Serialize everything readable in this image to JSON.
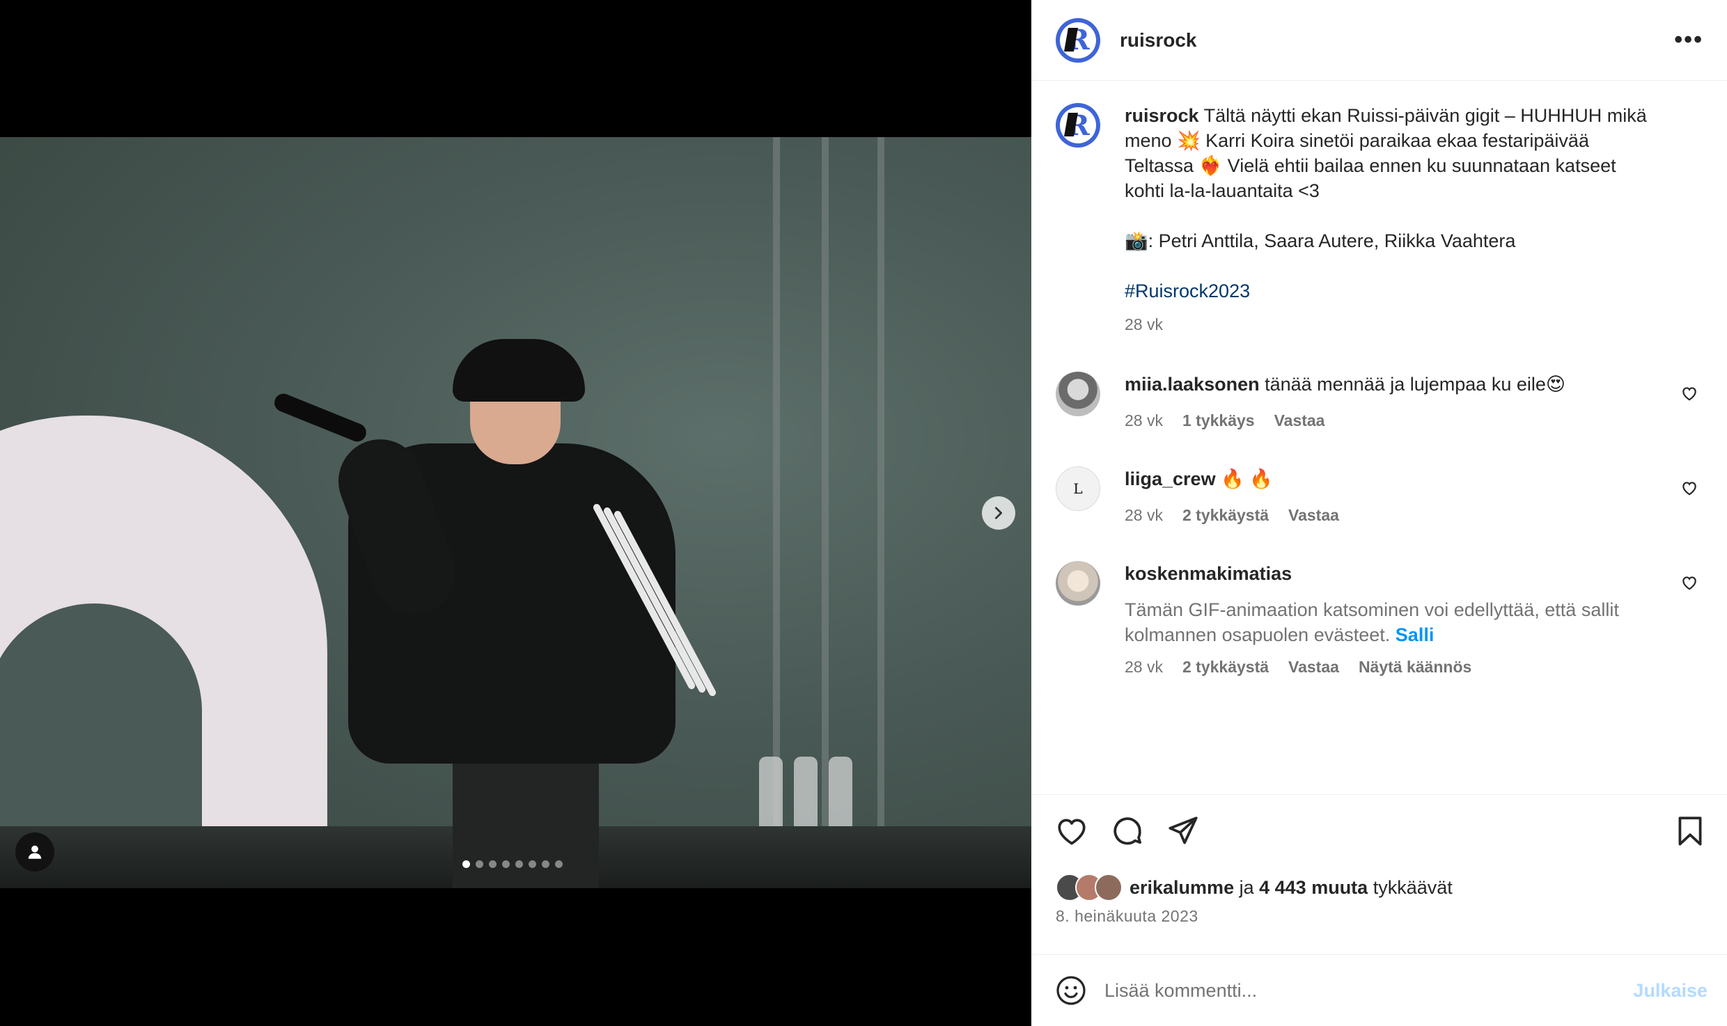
{
  "post": {
    "username": "ruisrock",
    "caption_line1": " Tältä näytti ekan Ruissi-päivän gigit – HUHHUH mikä",
    "caption_line2": "meno 💥 Karri Koira sinetöi paraikaa ekaa festaripäivää",
    "caption_line3": "Teltassa ❤️‍🔥 Vielä ehtii bailaa ennen ku suunnataan katseet",
    "caption_line4": "kohti la-la-lauantaita <3",
    "credits": "📸: Petri Anttila, Saara Autere, Riikka Vaahtera",
    "hashtag": "#Ruisrock2023",
    "time": "28 vk"
  },
  "comments": [
    {
      "user": "miia.laaksonen",
      "text": " tänää mennää ja lujempaa ku eile😍",
      "time": "28 vk",
      "likes": "1 tykkäys",
      "reply": "Vastaa"
    },
    {
      "user": "liiga_crew",
      "text": " 🔥 🔥",
      "time": "28 vk",
      "likes": "2 tykkäystä",
      "reply": "Vastaa"
    },
    {
      "user": "koskenmakimatias",
      "gif_note_line1": "Tämän GIF-animaation katsominen voi edellyttää, että sallit",
      "gif_note_line2": "kolmannen osapuolen evästeet.",
      "allow": "Salli",
      "time": "28 vk",
      "likes": "2 tykkäystä",
      "reply": "Vastaa",
      "translate": "Näytä käännös"
    }
  ],
  "likes": {
    "user": "erikalumme",
    "connector": " ja ",
    "count": "4 443 muuta",
    "suffix": " tykkäävät"
  },
  "date": "8. heinäkuuta 2023",
  "add_comment": {
    "placeholder": "Lisää kommentti...",
    "publish": "Julkaise"
  },
  "carousel": {
    "slides": 8,
    "current": 1
  },
  "colors": {
    "accent": "#0095f6",
    "hashtag": "#00376b",
    "muted": "#737373",
    "brand": "#3e64d8"
  },
  "icons": [
    "chevron-right-icon",
    "user-tag-icon",
    "more-icon",
    "heart-icon",
    "comment-icon",
    "share-icon",
    "bookmark-icon",
    "emoji-icon"
  ]
}
